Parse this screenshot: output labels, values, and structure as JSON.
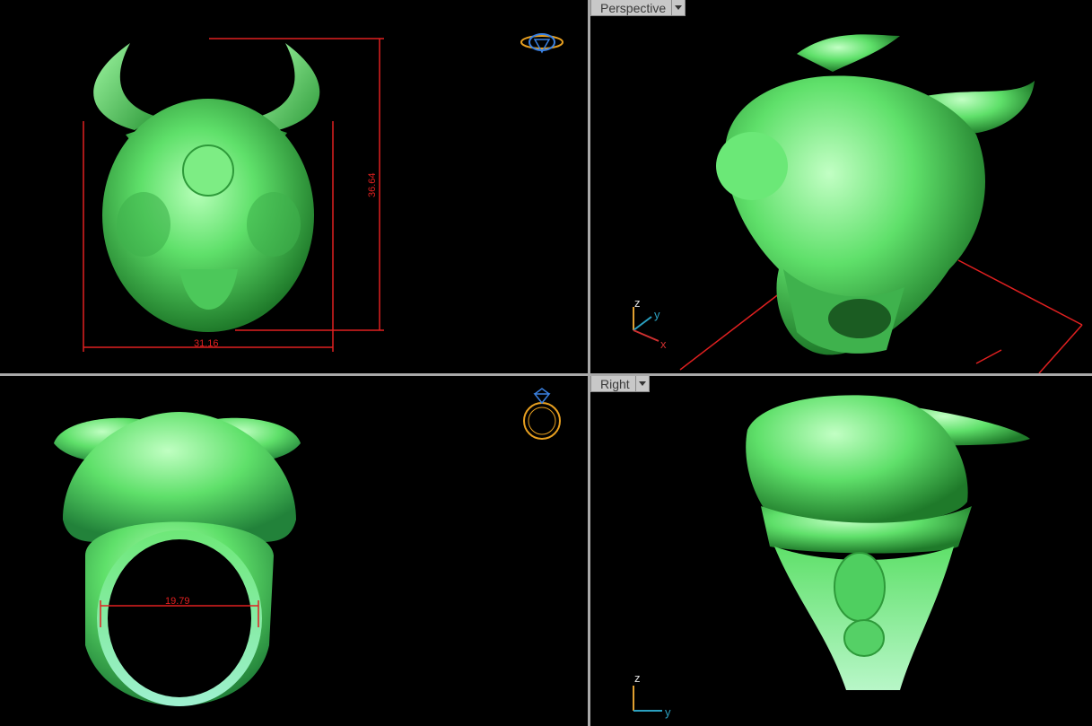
{
  "viewports": {
    "top_left": {
      "label": ""
    },
    "top_right": {
      "label": "Perspective"
    },
    "bottom_left": {
      "label": ""
    },
    "bottom_right": {
      "label": "Right"
    }
  },
  "dimensions": {
    "width": "31.16",
    "height": "36.64",
    "inner_diameter": "19.79"
  },
  "axes": {
    "perspective": {
      "z": "z",
      "y": "y",
      "x": "x"
    },
    "right": {
      "z": "z",
      "y": "y"
    }
  },
  "icons": {
    "top_left": "ring-diamond-top-icon",
    "bottom_left": "ring-side-icon"
  },
  "colors": {
    "model": "#5fe06a",
    "dimension": "#e02020",
    "background": "#000000",
    "splitter": "#a9a9a9",
    "axis_z": "#e0a030",
    "axis_y": "#2aa0c0",
    "axis_x": "#d03030",
    "icon_orange": "#e8a020",
    "icon_blue": "#3a80e0"
  }
}
